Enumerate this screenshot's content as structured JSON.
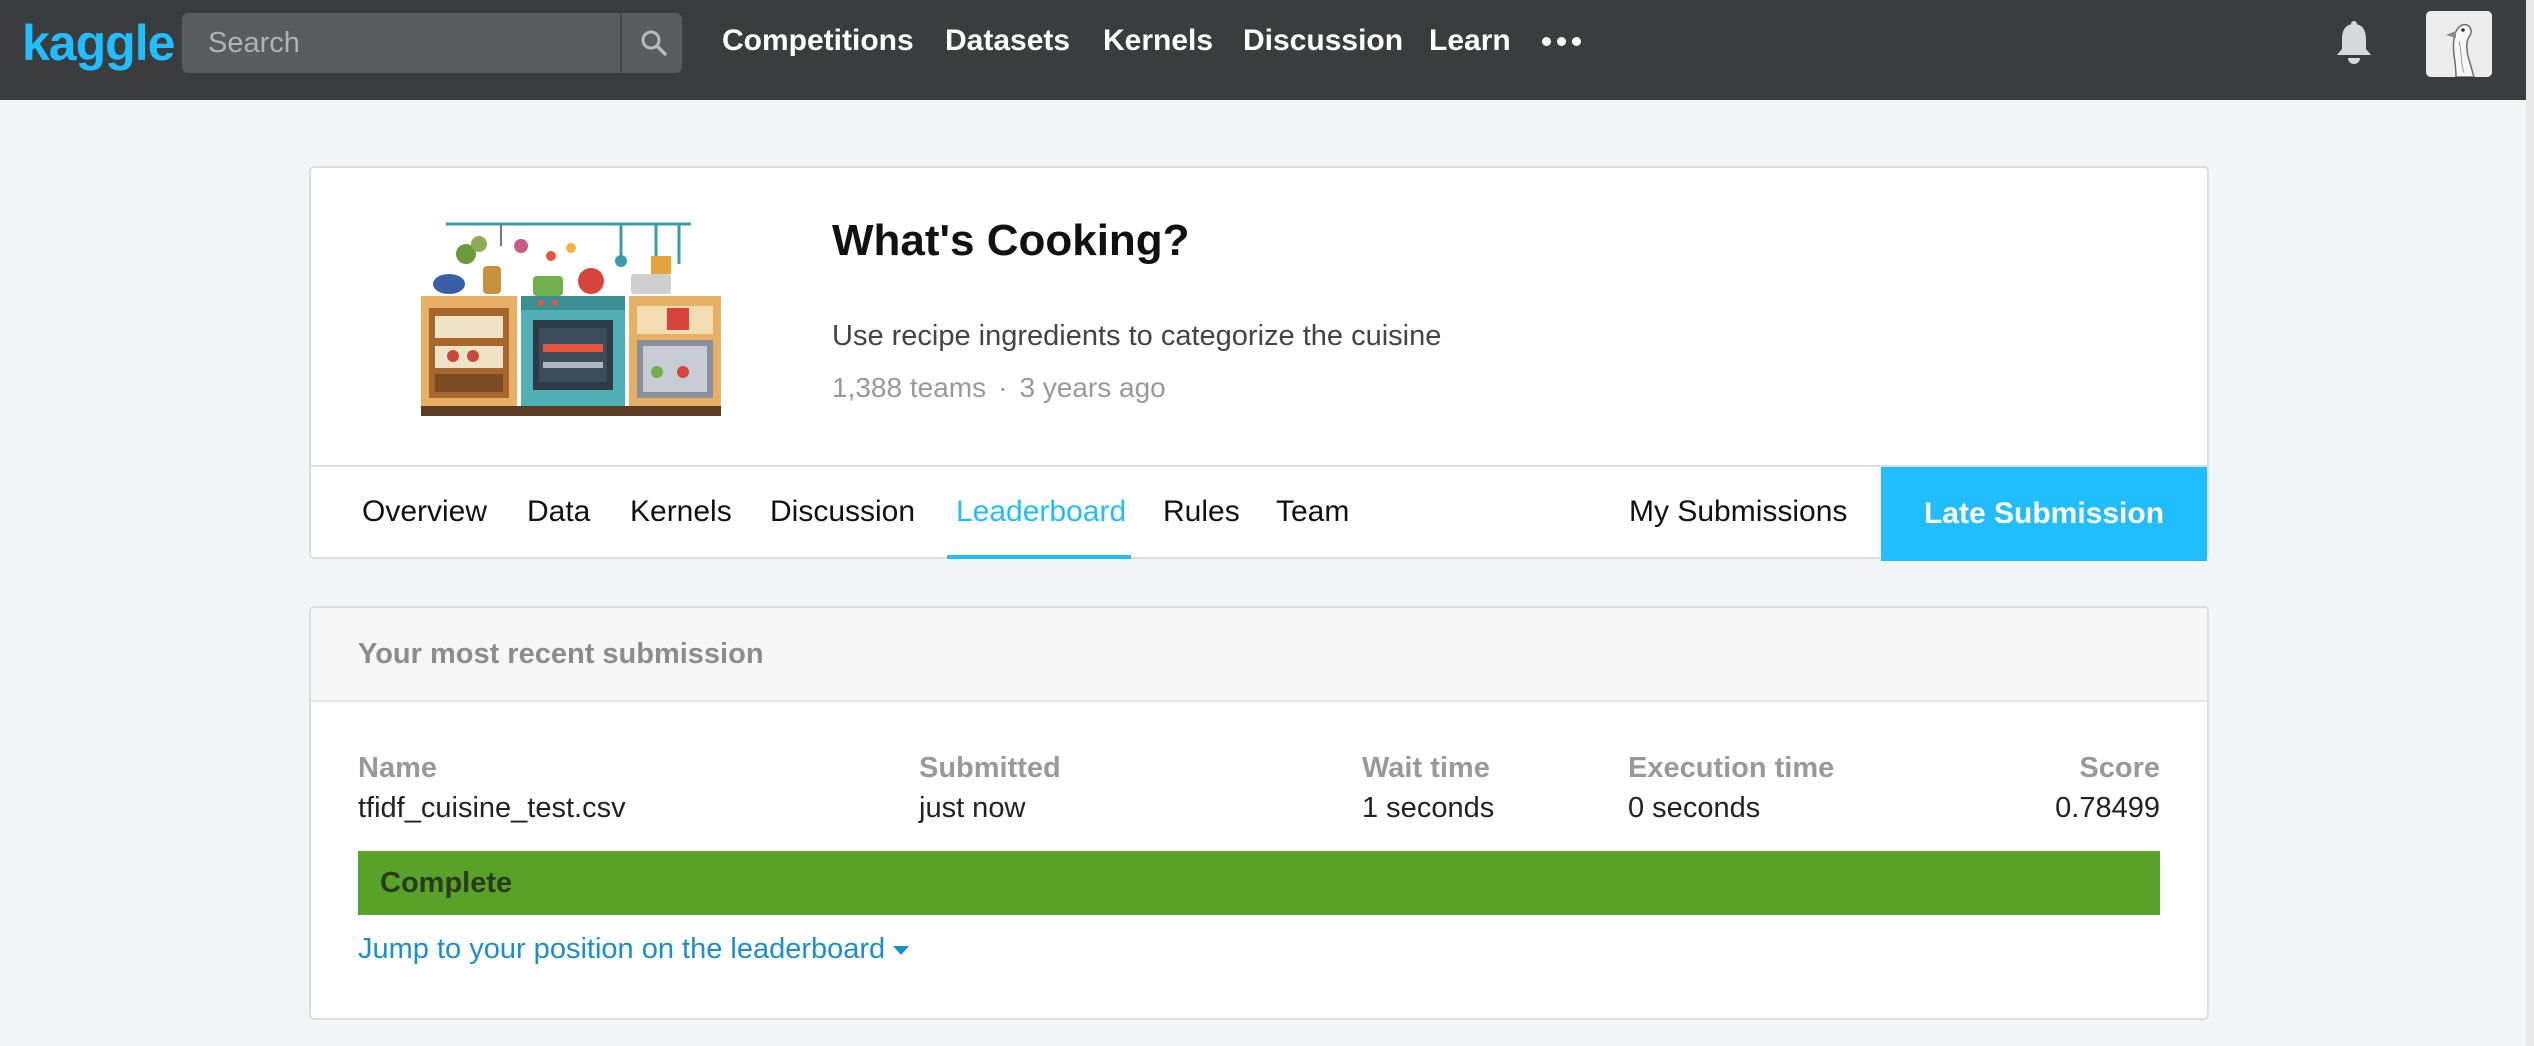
{
  "brand": {
    "logo_text": "kaggle",
    "accent_color": "#20beff"
  },
  "search": {
    "placeholder": "Search",
    "value": ""
  },
  "nav": {
    "items": [
      {
        "label": "Competitions"
      },
      {
        "label": "Datasets"
      },
      {
        "label": "Kernels"
      },
      {
        "label": "Discussion"
      },
      {
        "label": "Learn"
      }
    ],
    "more_icon": "ellipsis-icon",
    "notification_icon": "bell-icon",
    "avatar_icon": "user-avatar"
  },
  "competition": {
    "title": "What's Cooking?",
    "description": "Use recipe ingredients to categorize the cuisine",
    "teams": "1,388 teams",
    "separator": "·",
    "age": "3 years ago",
    "tabs": [
      {
        "label": "Overview"
      },
      {
        "label": "Data"
      },
      {
        "label": "Kernels"
      },
      {
        "label": "Discussion"
      },
      {
        "label": "Leaderboard"
      },
      {
        "label": "Rules"
      },
      {
        "label": "Team"
      }
    ],
    "active_tab": "Leaderboard",
    "my_submissions_label": "My Submissions",
    "late_submission_label": "Late Submission"
  },
  "submission": {
    "header": "Your most recent submission",
    "columns": {
      "name": "Name",
      "submitted": "Submitted",
      "wait_time": "Wait time",
      "execution_time": "Execution time",
      "score": "Score"
    },
    "values": {
      "name": "tfidf_cuisine_test.csv",
      "submitted": "just now",
      "wait_time": "1 seconds",
      "execution_time": "0 seconds",
      "score": "0.78499"
    },
    "status": "Complete",
    "status_color": "#58a22a",
    "jump_link": "Jump to your position on the leaderboard"
  }
}
